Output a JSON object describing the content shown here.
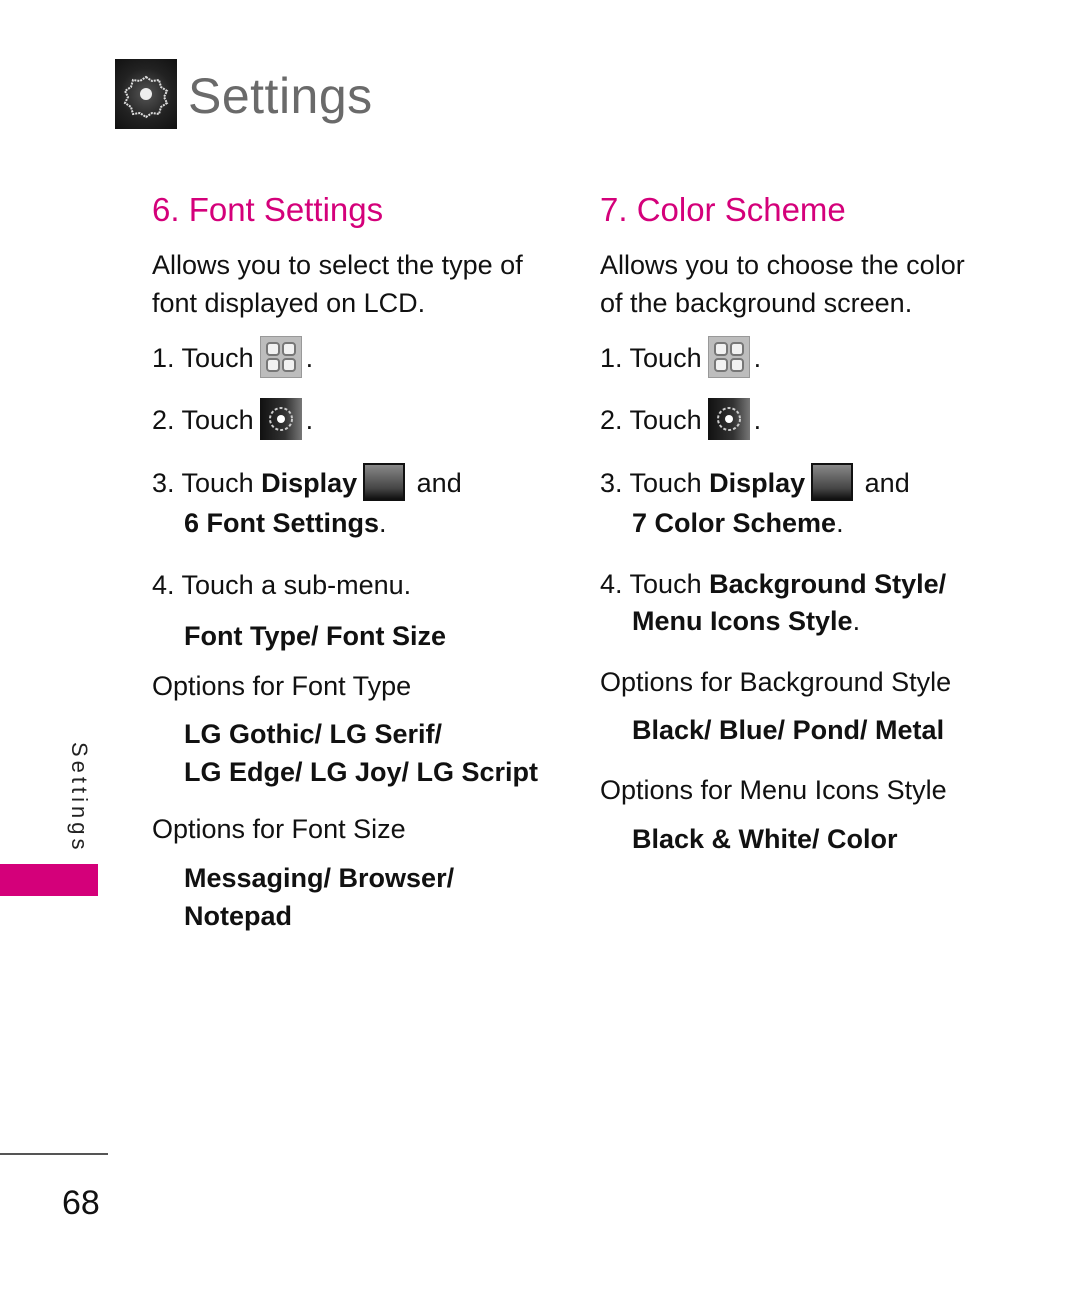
{
  "header": {
    "title": "Settings",
    "icon": "settings-gear-icon"
  },
  "left_section": {
    "title": "6. Font Settings",
    "description": [
      "Allows you to select the type of",
      "font displayed on LCD."
    ],
    "steps": {
      "s1_prefix": "1. Touch",
      "s1_suffix": ".",
      "s1_icon": "menu-grid-icon",
      "s2_prefix": "2. Touch",
      "s2_suffix": ".",
      "s2_icon": "settings-gear-icon",
      "s3_prefix": "3. Touch ",
      "s3_bold": "Display",
      "s3_icon": "display-monitor-icon",
      "s3_and": "and",
      "s3_line2": "6 Font Settings",
      "s3_line2_suffix": ".",
      "s4": "4. Touch a sub-menu.",
      "s4_options": "Font Type/ Font Size"
    },
    "font_type_label": "Options for Font Type",
    "font_type_options": [
      "LG Gothic/ LG Serif/",
      "LG Edge/ LG Joy/ LG Script"
    ],
    "font_size_label": "Options for Font Size",
    "font_size_options": [
      "Messaging/ Browser/",
      "Notepad"
    ]
  },
  "right_section": {
    "title": "7. Color Scheme",
    "description": [
      "Allows you to choose the color",
      "of the background screen."
    ],
    "steps": {
      "s1_prefix": "1. Touch",
      "s1_suffix": ".",
      "s2_prefix": "2. Touch",
      "s2_suffix": ".",
      "s3_prefix": "3. Touch ",
      "s3_bold": "Display",
      "s3_and": "and",
      "s3_line2": "7 Color Scheme",
      "s3_line2_suffix": ".",
      "s4_prefix": "4. Touch ",
      "s4_bold1": "Background Style/",
      "s4_bold2": "Menu Icons Style",
      "s4_suffix": "."
    },
    "bg_style_label": "Options for Background Style",
    "bg_style_options": "Black/ Blue/ Pond/ Metal",
    "menu_icons_label": "Options for Menu Icons Style",
    "menu_icons_options": "Black & White/ Color"
  },
  "side_tab": {
    "label": "Settings",
    "accent_color": "#d4007a"
  },
  "footer": {
    "page_number": "68"
  }
}
